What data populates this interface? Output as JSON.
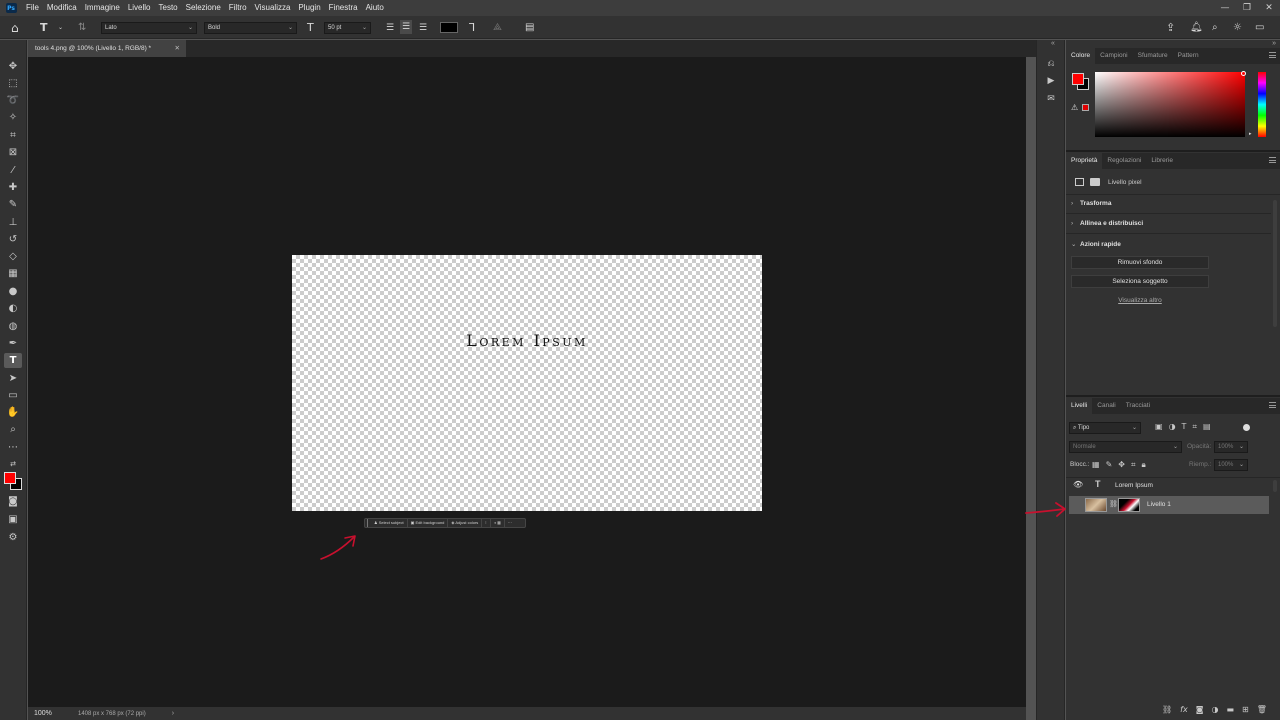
{
  "menubar": {
    "logo": "Ps",
    "items": [
      "File",
      "Modifica",
      "Immagine",
      "Livello",
      "Testo",
      "Selezione",
      "Filtro",
      "Visualizza",
      "Plugin",
      "Finestra",
      "Aiuto"
    ],
    "window_controls": [
      "—",
      "❐",
      "✕"
    ]
  },
  "options": {
    "font_family": "Lato",
    "font_style": "Bold",
    "font_size": "50 pt",
    "color_swatch": "#000000"
  },
  "document": {
    "tab_title": "tools 4.png @ 100% (Livello 1, RGB/8) *",
    "canvas_text": "Lorem Ipsum",
    "zoom": "100%",
    "dimensions": "1408 px x 768 px (72 ppi)"
  },
  "contextual_bar": {
    "buttons": [
      "Select subject",
      "Edit background",
      "Adjust colors"
    ]
  },
  "color_panel": {
    "tabs": [
      "Colore",
      "Campioni",
      "Sfumature",
      "Pattern"
    ],
    "foreground": "#ff0000",
    "background": "#000000"
  },
  "properties_panel": {
    "tabs": [
      "Proprietà",
      "Regolazioni",
      "Librerie"
    ],
    "layer_kind": "Livello pixel",
    "sections": [
      "Trasforma",
      "Allinea e distribuisci",
      "Azioni rapide"
    ],
    "buttons": [
      "Rimuovi sfondo",
      "Seleziona soggetto"
    ],
    "link": "Visualizza altro"
  },
  "layers_panel": {
    "tabs": [
      "Livelli",
      "Canali",
      "Tracciati"
    ],
    "filter": "Tipo",
    "blend_mode": "Normale",
    "opacity_label": "Opacità:",
    "opacity_value": "100%",
    "lock_label": "Blocc.:",
    "fill_label": "Riemp.:",
    "fill_value": "100%",
    "layers": [
      {
        "name": "Lorem Ipsum",
        "type": "text",
        "visible": true
      },
      {
        "name": "Livello 1",
        "type": "pixel",
        "visible": false,
        "selected": true
      }
    ],
    "footer_icons": [
      "link-icon",
      "fx-icon",
      "mask-icon",
      "adjustment-icon",
      "group-icon",
      "new-layer-icon",
      "trash-icon"
    ]
  },
  "annotations": {
    "arrow_color": "#c8102e"
  }
}
